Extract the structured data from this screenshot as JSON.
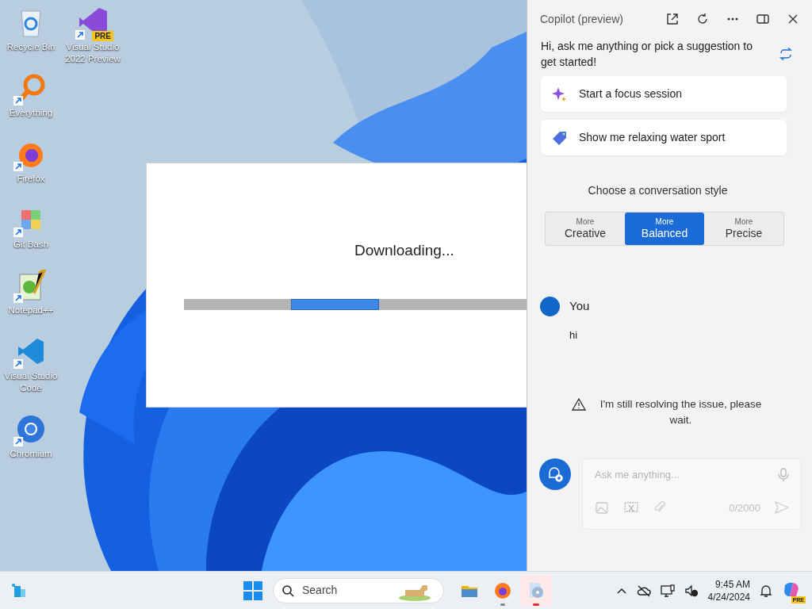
{
  "desktop": {
    "columns": [
      [
        {
          "label": "Recycle Bin",
          "kind": "recycle",
          "shortcut": false
        },
        {
          "label": "Everything",
          "kind": "everything",
          "shortcut": true
        },
        {
          "label": "Firefox",
          "kind": "firefox",
          "shortcut": true
        },
        {
          "label": "Git Bash",
          "kind": "git",
          "shortcut": true
        },
        {
          "label": "Notepad++",
          "kind": "notepad",
          "shortcut": true
        },
        {
          "label": "Visual Studio Code",
          "kind": "vscode",
          "shortcut": true
        },
        {
          "label": "Chromium",
          "kind": "chromium",
          "shortcut": true
        }
      ],
      [
        {
          "label": "Visual Studio 2022 Preview",
          "kind": "vs",
          "shortcut": true,
          "badge": "PRE"
        }
      ]
    ]
  },
  "dialog": {
    "message": "Downloading...",
    "progress": {
      "indeterminate": true
    }
  },
  "copilot": {
    "title": "Copilot (preview)",
    "greeting": "Hi, ask me anything or pick a suggestion to get started!",
    "suggestions": [
      {
        "label": "Start a focus session",
        "kind": "sparkle"
      },
      {
        "label": "Show me relaxing water sport",
        "kind": "tag"
      }
    ],
    "style_heading": "Choose a conversation style",
    "styles": [
      {
        "top": "More",
        "label": "Creative",
        "selected": false
      },
      {
        "top": "More",
        "label": "Balanced",
        "selected": true
      },
      {
        "top": "More",
        "label": "Precise",
        "selected": false
      }
    ],
    "messages": [
      {
        "author": "You",
        "text": "hi"
      }
    ],
    "notice": "I'm still resolving the issue, please wait.",
    "input": {
      "placeholder": "Ask me anything...",
      "counter": "0/2000"
    }
  },
  "taskbar": {
    "search_placeholder": "Search",
    "apps": [
      {
        "kind": "explorer",
        "running": false,
        "active": false
      },
      {
        "kind": "firefox",
        "running": true,
        "active": false
      },
      {
        "kind": "disc",
        "running": true,
        "active": true
      }
    ],
    "time": "9:45 AM",
    "date": "4/24/2024",
    "copilot_badge": "PRE"
  }
}
